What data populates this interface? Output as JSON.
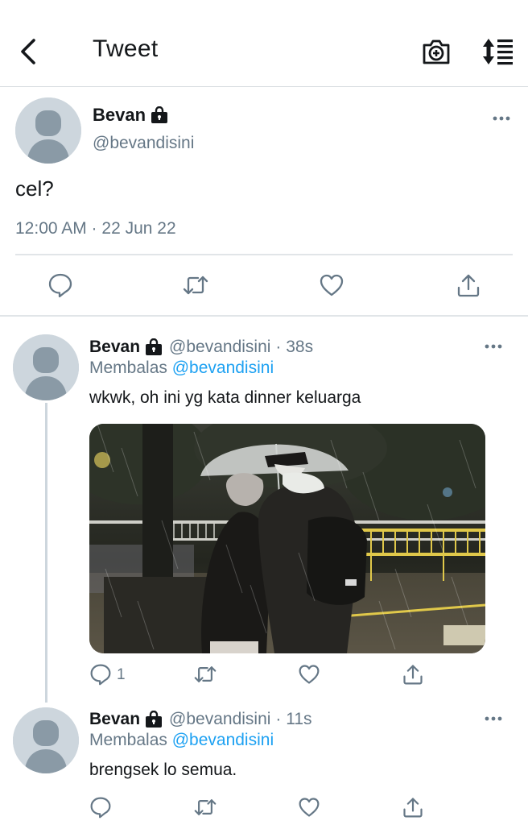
{
  "header": {
    "title": "Tweet",
    "icons": {
      "back": "chevron-left-icon",
      "camera": "camera-plus-icon",
      "sort": "sort-icon"
    }
  },
  "main_tweet": {
    "name": "Bevan",
    "handle": "@bevandisini",
    "text": "cel?",
    "timestamp": "12:00 AM · 22 Jun 22"
  },
  "replies": [
    {
      "name": "Bevan",
      "handle": "@bevandisini",
      "time": "· 38s",
      "replying_prefix": "Membalas",
      "replying_to": "@bevandisini",
      "text": "wkwk, oh ini yg kata dinner keluarga",
      "reply_count": "1"
    },
    {
      "name": "Bevan",
      "handle": "@bevandisini",
      "time": "· 11s",
      "replying_prefix": "Membalas",
      "replying_to": "@bevandisini",
      "text": "brengsek lo semua."
    }
  ],
  "colors": {
    "text": "#14171a",
    "muted": "#657786",
    "accent": "#1da1f2",
    "avatar_bg": "#cdd6dd",
    "avatar_fg": "#8a9aa6",
    "divider": "#e1e5e8"
  }
}
